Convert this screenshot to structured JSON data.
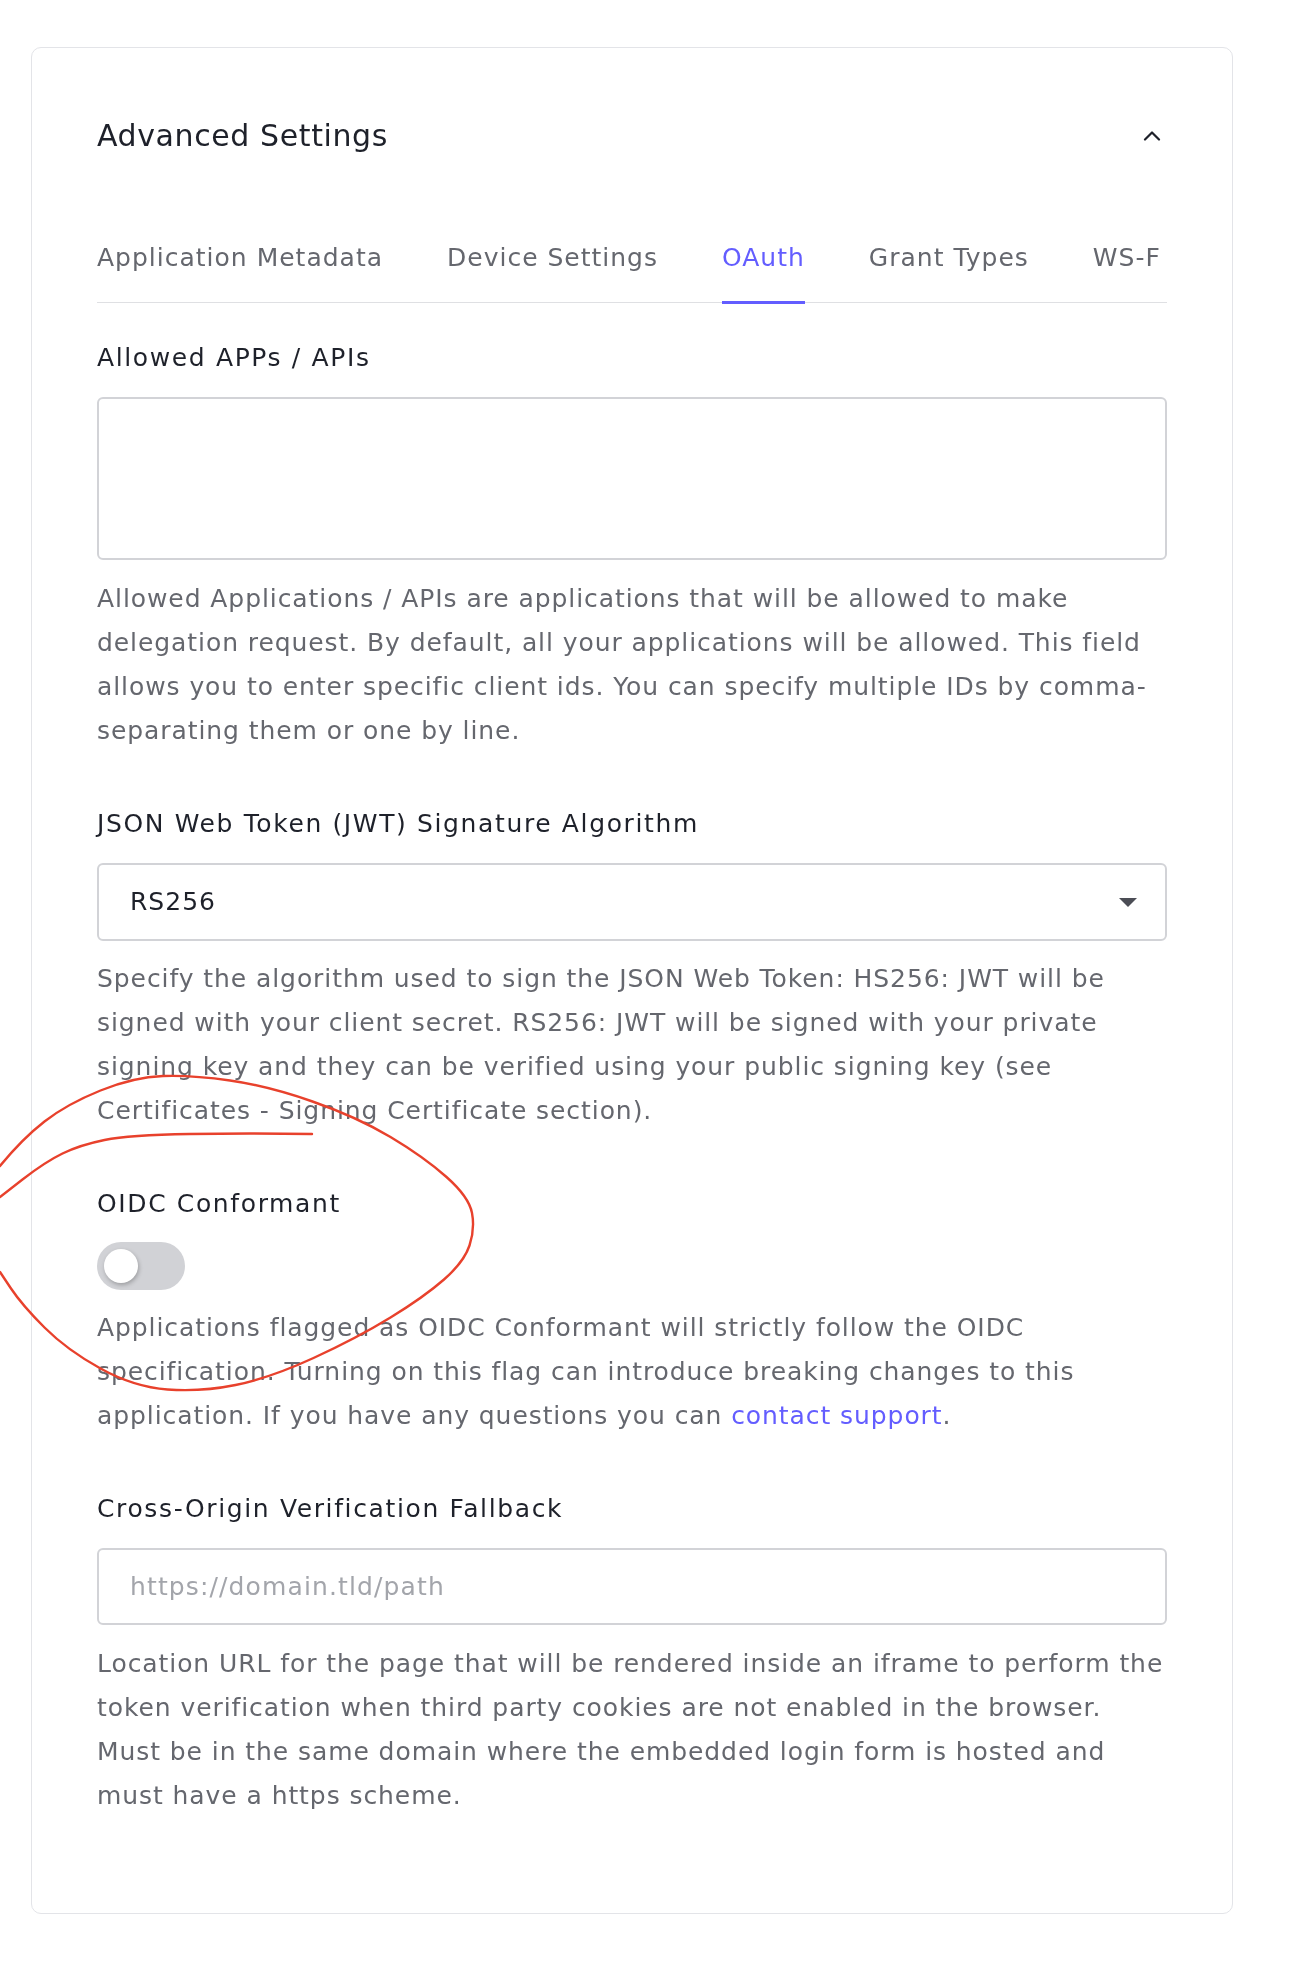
{
  "panel": {
    "title": "Advanced Settings",
    "expanded": true
  },
  "tabs": [
    {
      "label": "Application Metadata",
      "selected": false
    },
    {
      "label": "Device Settings",
      "selected": false
    },
    {
      "label": "OAuth",
      "selected": true
    },
    {
      "label": "Grant Types",
      "selected": false
    },
    {
      "label": "WS-F",
      "selected": false
    }
  ],
  "fields": [
    {
      "kind": "textarea",
      "label": "Allowed APPs / APIs",
      "help": [
        {
          "kind": "text",
          "text": "Allowed Applications / APIs are applications that will be allowed to make delegation request. By default, all your applications will be allowed. This field allows you to enter specific client ids. You can specify multiple IDs by comma-separating them or one by line."
        }
      ]
    },
    {
      "kind": "select",
      "label": "JSON Web Token (JWT) Signature Algorithm",
      "value": "RS256",
      "help": [
        {
          "kind": "text",
          "text": "Specify the algorithm used to sign the JSON Web Token: HS256: JWT will be signed with your client secret. RS256: JWT will be signed with your private signing key and they can be verified using your public signing key (see Certificates - Signing Certificate section)."
        }
      ]
    },
    {
      "kind": "toggle",
      "label": "OIDC Conformant",
      "on": false,
      "help": [
        {
          "kind": "text",
          "text": "Applications flagged as OIDC Conformant will strictly follow the OIDC specification. Turning on this flag can introduce breaking changes to this application. If you have any questions you can "
        },
        {
          "kind": "link",
          "text": "contact support"
        },
        {
          "kind": "text",
          "text": "."
        }
      ]
    },
    {
      "kind": "input",
      "label": "Cross-Origin Verification Fallback",
      "placeholder": "https://domain.tld/path",
      "help": [
        {
          "kind": "text",
          "text": "Location URL for the page that will be rendered inside an iframe to perform the token verification when third party cookies are not enabled in the browser. Must be in the same domain where the embedded login form is hosted and must have a https scheme."
        }
      ]
    }
  ]
}
